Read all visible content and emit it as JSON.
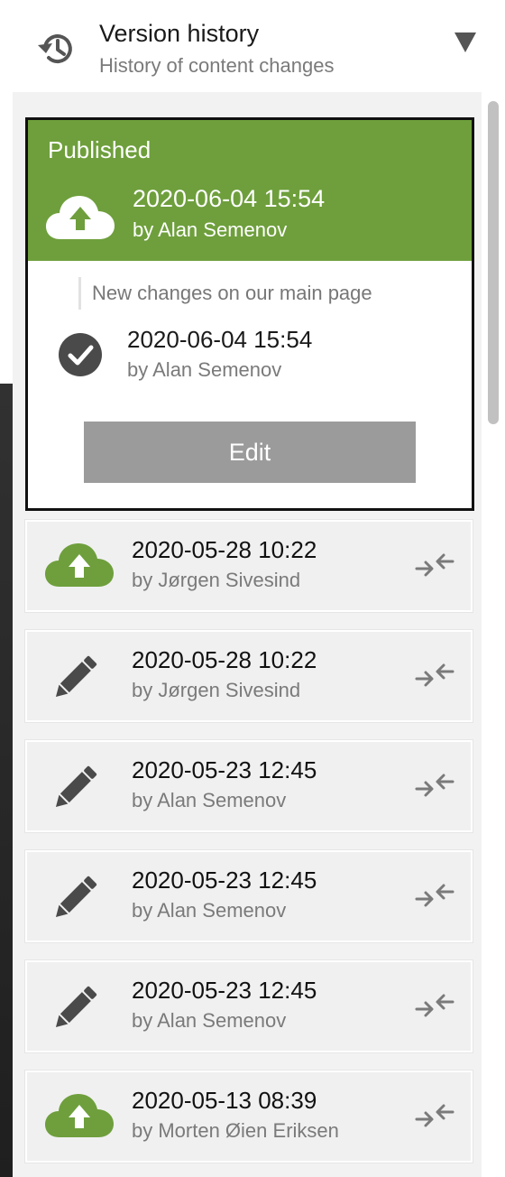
{
  "panel": {
    "title": "Version history",
    "subtitle": "History of content changes",
    "history_icon": "history-clock-icon",
    "collapse_icon": "triangle-down-icon"
  },
  "selected": {
    "status": "Published",
    "date": "2020-06-04 15:54",
    "author": "by Alan Semenov",
    "icon": "cloud-upload-icon",
    "message": "New changes on our main page",
    "body_date": "2020-06-04 15:54",
    "body_author": "by Alan Semenov",
    "body_icon": "check-circle-icon",
    "edit_label": "Edit"
  },
  "versions": [
    {
      "date": "2020-05-28 10:22",
      "author": "by Jørgen Sivesind",
      "icon": "cloud-upload-icon"
    },
    {
      "date": "2020-05-28 10:22",
      "author": "by Jørgen Sivesind",
      "icon": "pencil-icon"
    },
    {
      "date": "2020-05-23 12:45",
      "author": "by Alan Semenov",
      "icon": "pencil-icon"
    },
    {
      "date": "2020-05-23 12:45",
      "author": "by Alan Semenov",
      "icon": "pencil-icon"
    },
    {
      "date": "2020-05-23 12:45",
      "author": "by Alan Semenov",
      "icon": "pencil-icon"
    },
    {
      "date": "2020-05-13 08:39",
      "author": "by Morten Øien Eriksen",
      "icon": "cloud-upload-icon"
    }
  ],
  "colors": {
    "published": "#6e9f3c",
    "icon_dark": "#4a4a4a",
    "compare_icon": "#7a7a7a",
    "edit_button": "#9b9b9b"
  }
}
